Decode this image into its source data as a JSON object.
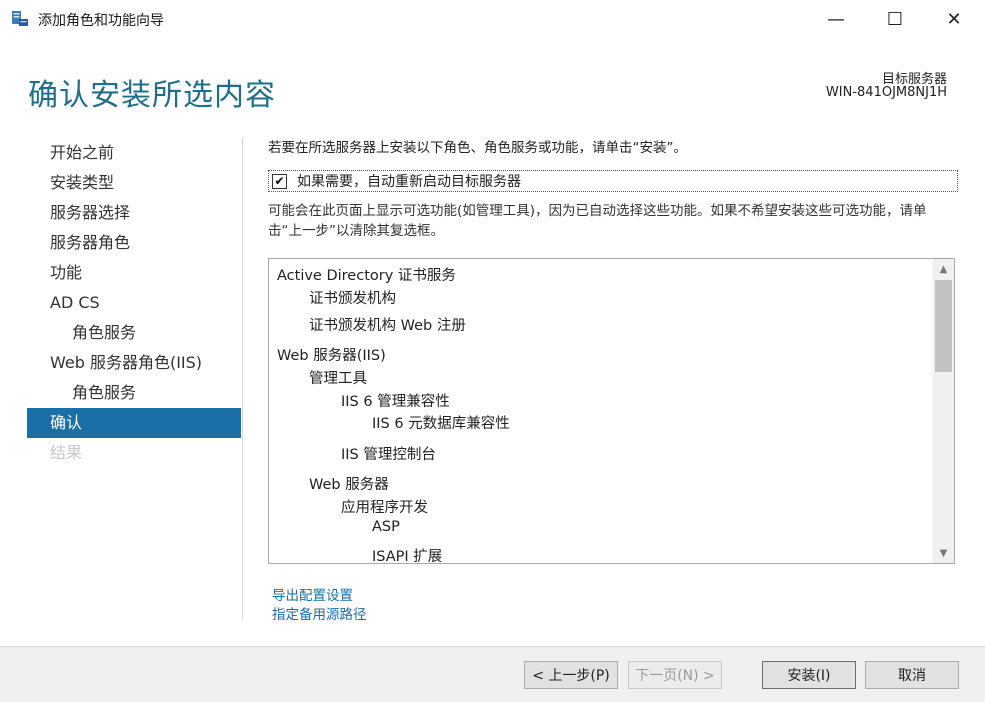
{
  "window": {
    "title": "添加角色和功能向导",
    "minimize_glyph": "—",
    "maximize_glyph": "☐",
    "close_glyph": "✕"
  },
  "header": {
    "page_title": "确认安装所选内容",
    "destination_label": "目标服务器",
    "destination_server": "WIN-841OJM8NJ1H"
  },
  "nav": {
    "items": [
      {
        "label": "开始之前",
        "state": "normal",
        "level": 0
      },
      {
        "label": "安装类型",
        "state": "normal",
        "level": 0
      },
      {
        "label": "服务器选择",
        "state": "normal",
        "level": 0
      },
      {
        "label": "服务器角色",
        "state": "normal",
        "level": 0
      },
      {
        "label": "功能",
        "state": "normal",
        "level": 0
      },
      {
        "label": "AD CS",
        "state": "normal",
        "level": 0
      },
      {
        "label": "角色服务",
        "state": "normal",
        "level": 1
      },
      {
        "label": "Web 服务器角色(IIS)",
        "state": "normal",
        "level": 0
      },
      {
        "label": "角色服务",
        "state": "normal",
        "level": 1
      },
      {
        "label": "确认",
        "state": "active",
        "level": 0
      },
      {
        "label": "结果",
        "state": "disabled",
        "level": 0
      }
    ]
  },
  "content": {
    "intro": "若要在所选服务器上安装以下角色、角色服务或功能，请单击“安装”。",
    "restart_checkbox": {
      "label": "如果需要，自动重新启动目标服务器",
      "checked": true,
      "check_glyph": "✔"
    },
    "note": "可能会在此页面上显示可选功能(如管理工具)，因为已自动选择这些功能。如果不希望安装这些可选功能，请单击“上一步”以清除其复选框。",
    "items": [
      {
        "text": "Active Directory 证书服务",
        "level": 0
      },
      {
        "text": "证书颁发机构",
        "level": 1
      },
      {
        "text": "证书颁发机构 Web 注册",
        "level": 1
      },
      {
        "text": "Web 服务器(IIS)",
        "level": 0
      },
      {
        "text": "管理工具",
        "level": 1
      },
      {
        "text": "IIS 6 管理兼容性",
        "level": 2
      },
      {
        "text": "IIS 6 元数据库兼容性",
        "level": 3
      },
      {
        "text": "IIS 管理控制台",
        "level": 2
      },
      {
        "text": "Web 服务器",
        "level": 1
      },
      {
        "text": "应用程序开发",
        "level": 2
      },
      {
        "text": "ASP",
        "level": 3
      },
      {
        "text": "ISAPI 扩展",
        "level": 3
      }
    ],
    "scroll_up_glyph": "▲",
    "scroll_down_glyph": "▼",
    "links": {
      "export": "导出配置设置",
      "alternate_source": "指定备用源路径"
    }
  },
  "footer": {
    "prev": "< 上一步(P)",
    "next": "下一页(N) >",
    "install": "安装(I)",
    "cancel": "取消"
  },
  "colors": {
    "accent": "#1a6fa6",
    "title": "#1f6f8b"
  }
}
